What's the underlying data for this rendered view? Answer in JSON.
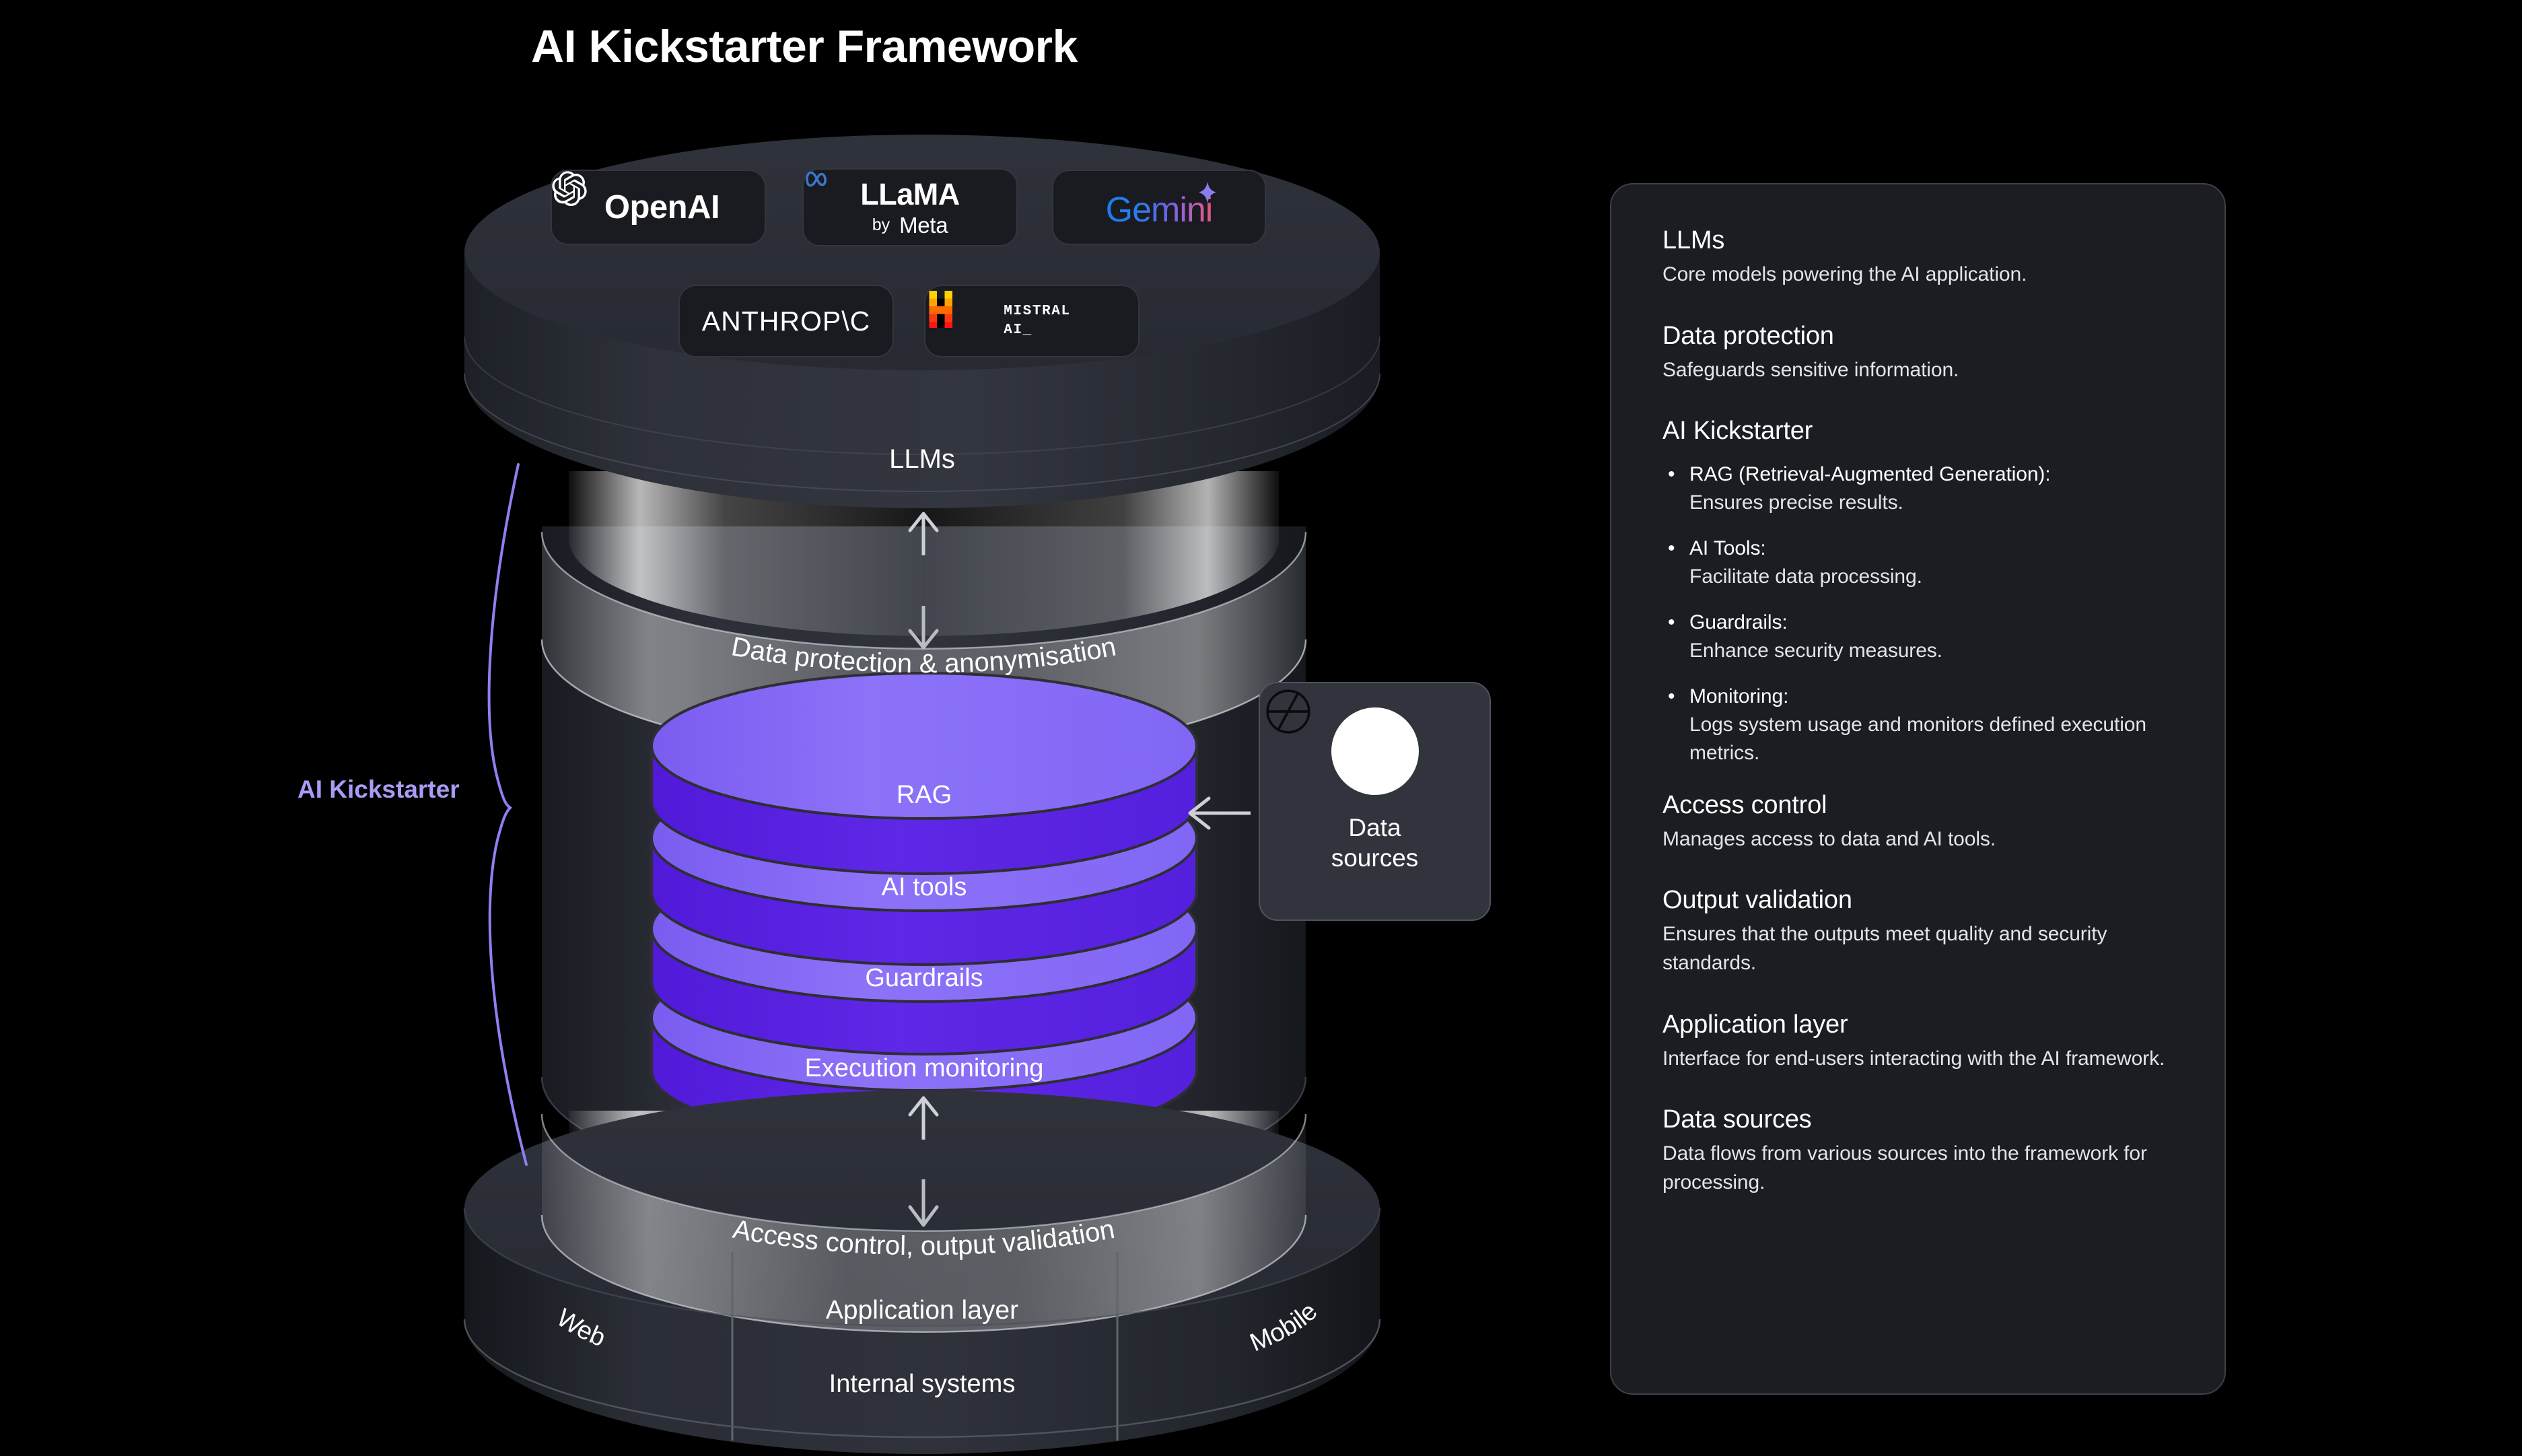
{
  "page": {
    "title": "AI Kickstarter Framework",
    "background_color": "#000000"
  },
  "colors": {
    "accent_purple": "#a99cf5",
    "disc_top": "#8266f5",
    "disc_side": "#5a22e0",
    "panel_bg": "#1b1d22",
    "panel_border": "#3d4048",
    "chip_bg": "#191b20",
    "cylinder_dark": "#2a2d35",
    "text_primary": "#ffffff",
    "text_secondary": "#e2e4e8"
  },
  "diagram": {
    "llm_chips": [
      {
        "id": "openai",
        "name": "OpenAI",
        "icon": "openai-logo-icon"
      },
      {
        "id": "llama",
        "name": "LLaMA",
        "sub_by": "by",
        "sub_brand": "Meta",
        "icon": "meta-infinity-icon"
      },
      {
        "id": "gemini",
        "name": "Gemini",
        "icon": "gemini-sparkle-icon"
      },
      {
        "id": "anthropic",
        "name": "ANTHROP\\C",
        "icon": "anthropic-wordmark-icon"
      },
      {
        "id": "mistral",
        "name_line1": "MISTRAL",
        "name_line2": "AI_",
        "icon": "mistral-m-icon"
      }
    ],
    "layers": [
      {
        "id": "llms",
        "label": "LLMs"
      },
      {
        "id": "data-protection",
        "label": "Data protection & anonymisation"
      },
      {
        "id": "rag",
        "label": "RAG"
      },
      {
        "id": "ai-tools",
        "label": "AI tools"
      },
      {
        "id": "guardrails",
        "label": "Guardrails"
      },
      {
        "id": "execution",
        "label": "Execution monitoring"
      },
      {
        "id": "access-control",
        "label": "Access control, output validation"
      },
      {
        "id": "application",
        "label": "Application layer"
      }
    ],
    "application_segments": [
      {
        "id": "web",
        "label": "Web"
      },
      {
        "id": "internal-systems",
        "label": "Internal systems"
      },
      {
        "id": "mobile",
        "label": "Mobile"
      }
    ],
    "bracket_label": "AI Kickstarter",
    "data_sources_card": {
      "label_line1": "Data",
      "label_line2": "sources",
      "icon": "pie-chart-icon"
    }
  },
  "legend": {
    "blocks": [
      {
        "id": "llms",
        "heading": "LLMs",
        "body": "Core models powering the AI application."
      },
      {
        "id": "data-protection",
        "heading": "Data protection",
        "body": "Safeguards sensitive information."
      },
      {
        "id": "ai-kickstarter",
        "heading": "AI Kickstarter",
        "bullets": [
          {
            "term": "RAG (Retrieval-Augmented Generation):",
            "desc": "Ensures precise results."
          },
          {
            "term": "AI Tools:",
            "desc": "Facilitate data processing."
          },
          {
            "term": "Guardrails:",
            "desc": "Enhance security measures."
          },
          {
            "term": "Monitoring:",
            "desc": "Logs system usage and monitors defined execution metrics."
          }
        ]
      },
      {
        "id": "access-control",
        "heading": "Access control",
        "body": "Manages access to data and AI tools."
      },
      {
        "id": "output-validation",
        "heading": "Output validation",
        "body": "Ensures that the outputs meet quality and security standards."
      },
      {
        "id": "application-layer",
        "heading": "Application layer",
        "body": "Interface for end-users interacting with the AI framework."
      },
      {
        "id": "data-sources",
        "heading": "Data sources",
        "body": "Data flows from various sources into the framework for processing."
      }
    ]
  }
}
